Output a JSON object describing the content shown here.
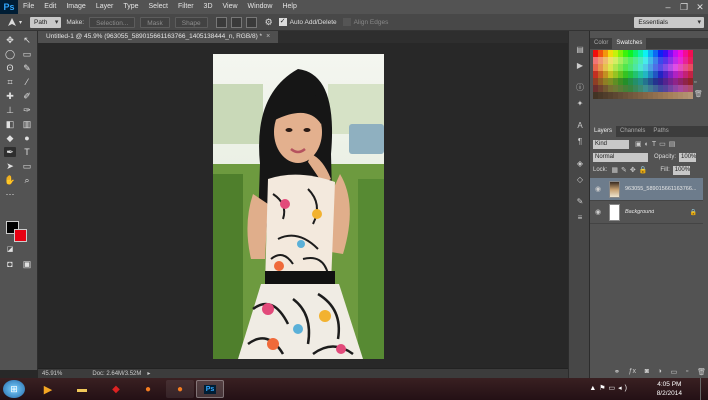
{
  "app": {
    "logo": "Ps"
  },
  "menu": [
    "File",
    "Edit",
    "Image",
    "Layer",
    "Type",
    "Select",
    "Filter",
    "3D",
    "View",
    "Window",
    "Help"
  ],
  "window_controls": [
    "–",
    "❐",
    "✕"
  ],
  "options_bar": {
    "mode_value": "Path",
    "make_label": "Make:",
    "selection_btn": "Selection...",
    "mask_btn": "Mask",
    "shape_btn": "Shape",
    "auto_add_label": "Auto Add/Delete",
    "align_edges_label": "Align Edges",
    "workspace_value": "Essentials"
  },
  "document": {
    "tab_title": "Untitled-1 @ 45.9% (963055_589015661163766_1405138444_n, RGB/8) *",
    "close": "×"
  },
  "status": {
    "zoom": "45.91%",
    "doc": "Doc: 2.64M/3.52M"
  },
  "color_panel": {
    "tab_color": "Color",
    "tab_swatches": "Swatches"
  },
  "layers_panel": {
    "tab_layers": "Layers",
    "tab_channels": "Channels",
    "tab_paths": "Paths",
    "kind_value": "Kind",
    "blend_value": "Normal",
    "opacity_label": "Opacity:",
    "opacity_value": "100%",
    "lock_label": "Lock:",
    "fill_label": "Fill:",
    "fill_value": "100%",
    "layers": [
      {
        "name": "963055_589015661163766..."
      },
      {
        "name": "Background"
      }
    ]
  },
  "taskbar": {
    "time": "4:05 PM",
    "date": "8/2/2014"
  },
  "colors": {
    "foreground": "#000000",
    "background": "#e60012"
  }
}
